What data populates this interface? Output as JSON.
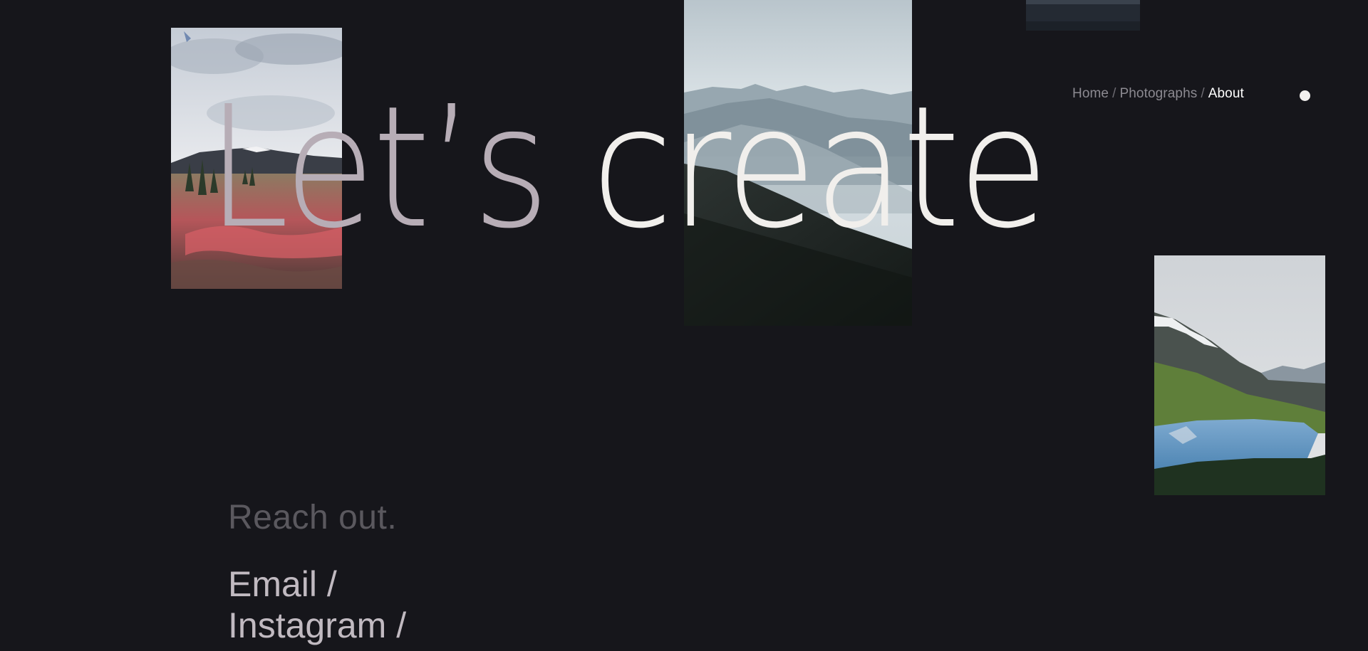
{
  "nav": {
    "items": [
      {
        "label": "Home",
        "active": false
      },
      {
        "label": "Photographs",
        "active": false
      },
      {
        "label": "About",
        "active": true
      }
    ],
    "separator": "/"
  },
  "headline": {
    "word1": "Let’s",
    "word2": "create"
  },
  "contact": {
    "heading": "Reach out.",
    "links": [
      "Email /",
      "Instagram /"
    ]
  },
  "photos": [
    {
      "icon": "meadow-photo"
    },
    {
      "icon": "mountain-forest-photo"
    },
    {
      "icon": "water-photo"
    },
    {
      "icon": "mountain-lake-photo"
    }
  ],
  "colors": {
    "background": "#16161b",
    "headline_muted": "#b7adb6",
    "headline_light": "#f1efec",
    "nav_text": "#8c8a91",
    "nav_active": "#ffffff",
    "reach_text": "#5a585e",
    "link_text": "#c1bac1"
  }
}
